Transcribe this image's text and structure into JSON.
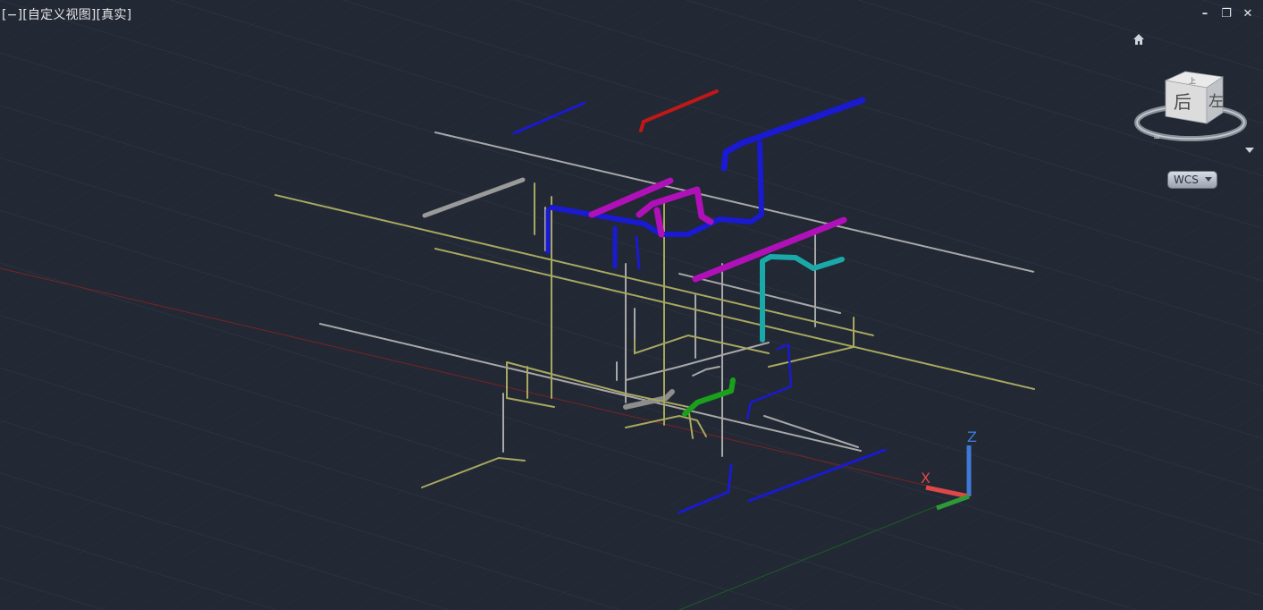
{
  "viewport": {
    "label": "[−][自定义视图][真实]",
    "background": "#222834",
    "grid_color": "#323a48"
  },
  "window_controls": {
    "minimize": "–",
    "restore": "❐",
    "close": "✕"
  },
  "viewcube": {
    "face_top": "上",
    "face_back": "后",
    "face_left": "左",
    "home_icon": "home-icon"
  },
  "wcs_menu": {
    "label": "WCS"
  },
  "ucs_icon": {
    "x_label": "X",
    "z_label": "Z"
  },
  "colors": {
    "pipe_blue": "#1a1ad0",
    "pipe_magenta": "#b010b8",
    "pipe_cyan": "#1aa8a8",
    "pipe_green": "#1aa01a",
    "pipe_red": "#c01818",
    "pipe_gray": "#a8a8a8",
    "pipe_yellow": "#a8a860",
    "axis_red": "#7a2424",
    "axis_green": "#1e5a28"
  }
}
